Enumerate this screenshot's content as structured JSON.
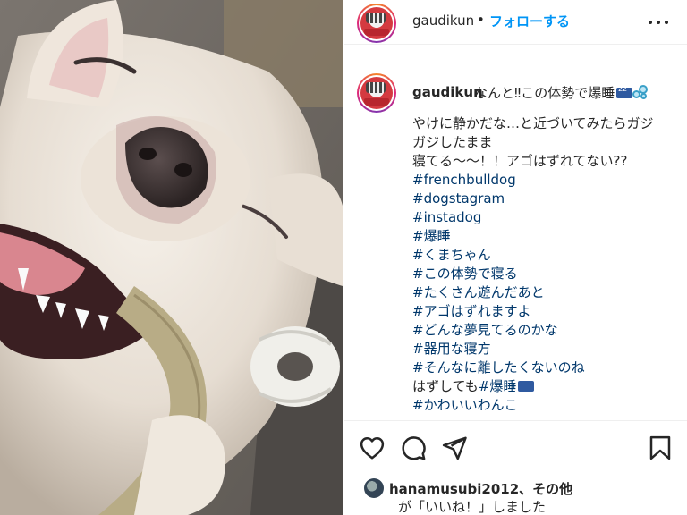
{
  "post": {
    "username": "gaudikun",
    "separator": "•",
    "follow_label": "フォローする"
  },
  "caption": {
    "username": "gaudikun",
    "title_text": "なんと‼この体勢で爆睡",
    "lines": [
      {
        "text": "やけに静かだな…と近づいてみたらガジ",
        "tag": false
      },
      {
        "text": "ガジしたまま",
        "tag": false
      },
      {
        "text": "寝てる〜〜！！アゴはずれてない??",
        "tag": false
      },
      {
        "text": "#frenchbulldog",
        "tag": true
      },
      {
        "text": "#dogstagram",
        "tag": true
      },
      {
        "text": "#instadog",
        "tag": true
      },
      {
        "text": "#爆睡",
        "tag": true
      },
      {
        "text": "#くまちゃん",
        "tag": true
      },
      {
        "text": "#この体勢で寝る",
        "tag": true
      },
      {
        "text": "#たくさん遊んだあと",
        "tag": true
      },
      {
        "text": "#アゴはずれますよ",
        "tag": true
      },
      {
        "text": "#どんな夢見てるのかな",
        "tag": true
      },
      {
        "text": "#器用な寝方",
        "tag": true
      },
      {
        "text": "#そんなに離したくないのね",
        "tag": true
      }
    ],
    "mixed_line": {
      "plain": "はずしても",
      "tag": "#爆睡"
    },
    "last_line": "#かわいいわんこ"
  },
  "likes": {
    "liker_text": "hanamusubi2012、その他",
    "liked_text": "が「いいね！」しました"
  },
  "icons": {
    "more": "more-options-icon",
    "like": "heart-icon",
    "comment": "comment-icon",
    "share": "share-icon",
    "save": "bookmark-icon"
  },
  "colors": {
    "link_blue": "#0095f6",
    "hashtag": "#00376b",
    "text": "#262626"
  }
}
